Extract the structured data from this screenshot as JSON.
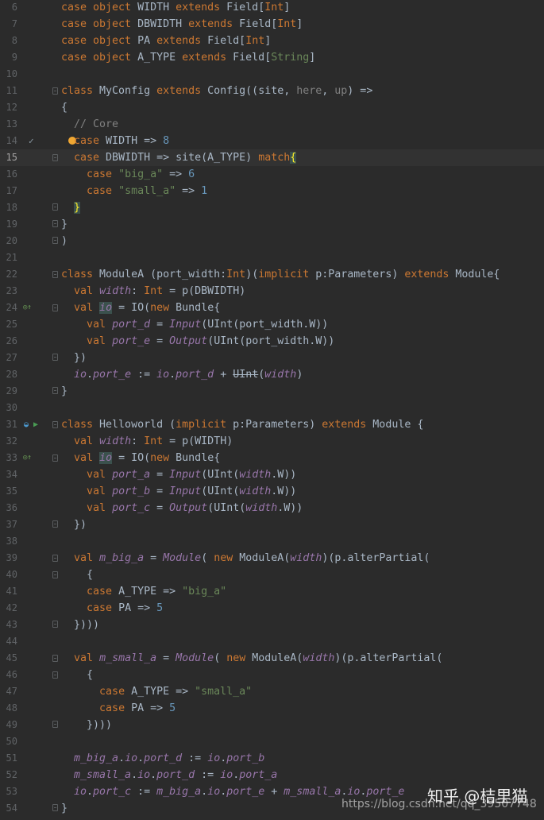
{
  "editor": {
    "lines": [
      {
        "n": "6",
        "code": "<span class=\"kw\">case object</span> WIDTH <span class=\"kw\">extends</span> Field[<span class=\"kw\">Int</span>]"
      },
      {
        "n": "7",
        "code": "<span class=\"kw\">case object</span> DBWIDTH <span class=\"kw\">extends</span> Field[<span class=\"kw\">Int</span>]"
      },
      {
        "n": "8",
        "code": "<span class=\"kw\">case object</span> PA <span class=\"kw\">extends</span> Field[<span class=\"kw\">Int</span>]"
      },
      {
        "n": "9",
        "code": "<span class=\"kw\">case object</span> A_TYPE <span class=\"kw\">extends</span> Field[<span class=\"typ\">String</span>]"
      },
      {
        "n": "10",
        "code": ""
      },
      {
        "n": "11",
        "code": "<span class=\"kw\">class</span> MyConfig <span class=\"kw\">extends</span> Config((site, <span class=\"par\">here</span>, <span class=\"par\">up</span>) =>"
      },
      {
        "n": "12",
        "code": "{"
      },
      {
        "n": "13",
        "code": "  <span class=\"cmt\">// Core</span>"
      },
      {
        "n": "14",
        "code": "  <span class=\"kw\">case</span> WIDTH => <span class=\"num\">8</span>"
      },
      {
        "n": "15",
        "code": "  <span class=\"kw\">case</span> DBWIDTH => site(A_TYPE) <span class=\"kw\">match</span><span class=\"brace-hl\">{</span>"
      },
      {
        "n": "16",
        "code": "    <span class=\"kw\">case</span> <span class=\"str\">\"big_a\"</span> => <span class=\"num\">6</span>"
      },
      {
        "n": "17",
        "code": "    <span class=\"kw\">case</span> <span class=\"str\">\"small_a\"</span> => <span class=\"num\">1</span>"
      },
      {
        "n": "18",
        "code": "  <span class=\"brace-hl\">}</span>"
      },
      {
        "n": "19",
        "code": "}"
      },
      {
        "n": "20",
        "code": ")"
      },
      {
        "n": "21",
        "code": ""
      },
      {
        "n": "22",
        "code": "<span class=\"kw\">class</span> ModuleA (port_width:<span class=\"kw\">Int</span>)(<span class=\"kw\">implicit</span> p:Parameters) <span class=\"kw\">extends</span> Module{"
      },
      {
        "n": "23",
        "code": "  <span class=\"kw\">val</span> <span class=\"it\">width</span>: <span class=\"kw\">Int</span> = p(DBWIDTH)"
      },
      {
        "n": "24",
        "code": "  <span class=\"kw\">val</span> <span class=\"it hl\">io</span> = IO(<span class=\"kw\">new</span> Bundle{"
      },
      {
        "n": "25",
        "code": "    <span class=\"kw\">val</span> <span class=\"it\">port_d</span> = <span class=\"fn\">Input</span>(UInt(port_width.W))"
      },
      {
        "n": "26",
        "code": "    <span class=\"kw\">val</span> <span class=\"it\">port_e</span> = <span class=\"fn\">Output</span>(UInt(port_width.W))"
      },
      {
        "n": "27",
        "code": "  })"
      },
      {
        "n": "28",
        "code": "  <span class=\"it\">io</span>.<span class=\"it\">port_e</span> := <span class=\"it\">io</span>.<span class=\"it\">port_d</span> + <span class=\"strike\">UInt</span>(<span class=\"it\">width</span>)"
      },
      {
        "n": "29",
        "code": "}"
      },
      {
        "n": "30",
        "code": ""
      },
      {
        "n": "31",
        "code": "<span class=\"kw\">class</span> Helloworld (<span class=\"kw\">implicit</span> p:Parameters) <span class=\"kw\">extends</span> Module {"
      },
      {
        "n": "32",
        "code": "  <span class=\"kw\">val</span> <span class=\"it\">width</span>: <span class=\"kw\">Int</span> = p(WIDTH)"
      },
      {
        "n": "33",
        "code": "  <span class=\"kw\">val</span> <span class=\"it hl\">io</span> = IO(<span class=\"kw\">new</span> Bundle{"
      },
      {
        "n": "34",
        "code": "    <span class=\"kw\">val</span> <span class=\"it\">port_a</span> = <span class=\"fn\">Input</span>(UInt(<span class=\"it\">width</span>.W))"
      },
      {
        "n": "35",
        "code": "    <span class=\"kw\">val</span> <span class=\"it\">port_b</span> = <span class=\"fn\">Input</span>(UInt(<span class=\"it\">width</span>.W))"
      },
      {
        "n": "36",
        "code": "    <span class=\"kw\">val</span> <span class=\"it\">port_c</span> = <span class=\"fn\">Output</span>(UInt(<span class=\"it\">width</span>.W))"
      },
      {
        "n": "37",
        "code": "  })"
      },
      {
        "n": "38",
        "code": ""
      },
      {
        "n": "39",
        "code": "  <span class=\"kw\">val</span> <span class=\"it\">m_big_a</span> = <span class=\"fn\">Module</span>( <span class=\"kw\">new</span> ModuleA(<span class=\"it\">width</span>)(p.alterPartial("
      },
      {
        "n": "40",
        "code": "    {"
      },
      {
        "n": "41",
        "code": "    <span class=\"kw\">case</span> A_TYPE => <span class=\"str\">\"big_a\"</span>"
      },
      {
        "n": "42",
        "code": "    <span class=\"kw\">case</span> PA => <span class=\"num\">5</span>"
      },
      {
        "n": "43",
        "code": "  })))"
      },
      {
        "n": "44",
        "code": ""
      },
      {
        "n": "45",
        "code": "  <span class=\"kw\">val</span> <span class=\"it\">m_small_a</span> = <span class=\"fn\">Module</span>( <span class=\"kw\">new</span> ModuleA(<span class=\"it\">width</span>)(p.alterPartial("
      },
      {
        "n": "46",
        "code": "    {"
      },
      {
        "n": "47",
        "code": "      <span class=\"kw\">case</span> A_TYPE => <span class=\"str\">\"small_a\"</span>"
      },
      {
        "n": "48",
        "code": "      <span class=\"kw\">case</span> PA => <span class=\"num\">5</span>"
      },
      {
        "n": "49",
        "code": "    })))"
      },
      {
        "n": "50",
        "code": ""
      },
      {
        "n": "51",
        "code": "  <span class=\"it\">m_big_a</span>.<span class=\"it\">io</span>.<span class=\"it\">port_d</span> := <span class=\"it\">io</span>.<span class=\"it\">port_b</span>"
      },
      {
        "n": "52",
        "code": "  <span class=\"it\">m_small_a</span>.<span class=\"it\">io</span>.<span class=\"it\">port_d</span> := <span class=\"it\">io</span>.<span class=\"it\">port_a</span>"
      },
      {
        "n": "53",
        "code": "  <span class=\"it\">io</span>.<span class=\"it\">port_c</span> := <span class=\"it\">m_big_a</span>.<span class=\"it\">io</span>.<span class=\"it\">port_e</span> + <span class=\"it\">m_small_a</span>.<span class=\"it\">io</span>.<span class=\"it\">port_e</span>"
      },
      {
        "n": "54",
        "code": "}"
      }
    ],
    "current_line": "15",
    "gutter_marks": {
      "14": "check-icon",
      "24": "override-icon",
      "31": "run-icon",
      "33": "override-icon"
    }
  },
  "watermark": {
    "zh": "知乎 @桔里猫",
    "url": "https://blog.csdn.net/qq_39507748"
  },
  "colors": {
    "background": "#2b2b2b",
    "keyword": "#cc7832",
    "string": "#6a8759",
    "number": "#6897bb",
    "field": "#9876aa",
    "line_number": "#606366"
  }
}
